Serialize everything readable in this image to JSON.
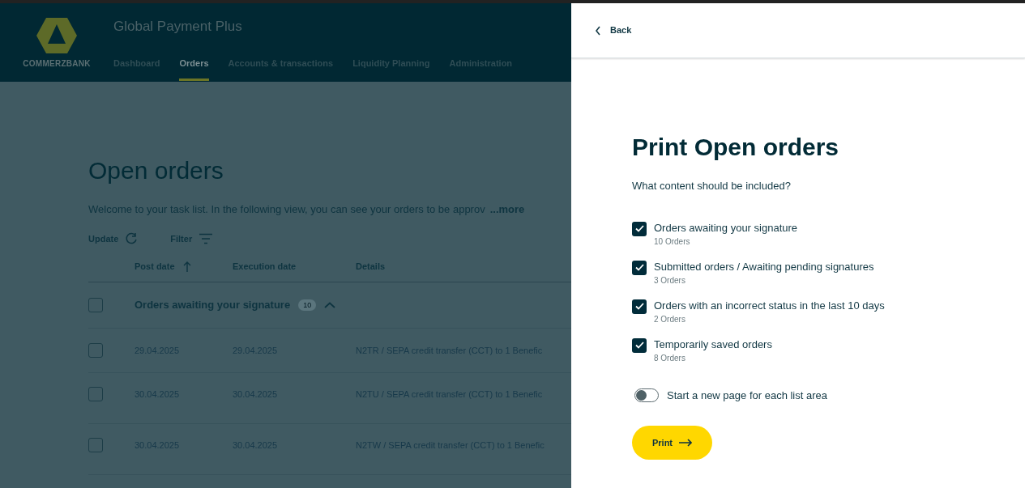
{
  "header": {
    "logo_text": "COMMERZBANK",
    "app_title": "Global Payment Plus",
    "nav": [
      {
        "label": "Dashboard",
        "selected": false
      },
      {
        "label": "Orders",
        "selected": true
      },
      {
        "label": "Accounts & transactions",
        "selected": false
      },
      {
        "label": "Liquidity Planning",
        "selected": false
      },
      {
        "label": "Administration",
        "selected": false
      }
    ]
  },
  "page": {
    "title": "Open orders",
    "intro": "Welcome to your task list. In the following view, you can see your orders to be approv",
    "more_link": "...more",
    "toolbar": [
      {
        "kind": "update",
        "label": "Update"
      },
      {
        "kind": "filter",
        "label": "Filter"
      }
    ],
    "columns": [
      "Post date",
      "Execution date",
      "Details"
    ],
    "group": {
      "label": "Orders awaiting your signature",
      "count": "10",
      "checked": false,
      "expanded": true
    },
    "rows": [
      {
        "post_date": "29.04.2025",
        "execution_date": "29.04.2025",
        "details": "N2TR / SEPA credit transfer (CCT) to 1 Benefic",
        "checked": false
      },
      {
        "post_date": "30.04.2025",
        "execution_date": "30.04.2025",
        "details": "N2TU / SEPA credit transfer (CCT) to 1 Benefic",
        "checked": false
      },
      {
        "post_date": "30.04.2025",
        "execution_date": "30.04.2025",
        "details": "N2TW / SEPA credit transfer (CCT) to 1 Benefic",
        "checked": false
      }
    ]
  },
  "panel": {
    "back": "Back",
    "title": "Print Open orders",
    "question": "What content should be included?",
    "options": [
      {
        "label": "Orders awaiting your signature",
        "count": "10 Orders",
        "checked": true
      },
      {
        "label": "Submitted orders / Awaiting pending signatures",
        "count": "3 Orders",
        "checked": true
      },
      {
        "label": "Orders with an incorrect status in the last 10 days",
        "count": "2 Orders",
        "checked": true
      },
      {
        "label": "Temporarily saved orders",
        "count": "8 Orders",
        "checked": true
      }
    ],
    "toggle": {
      "label": "Start a new page for each list area",
      "on": false
    },
    "print_button": "Print"
  }
}
